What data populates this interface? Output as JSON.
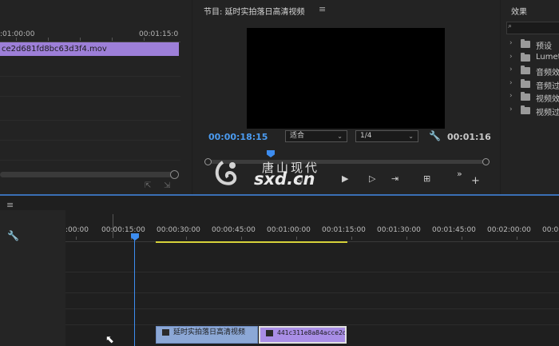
{
  "source": {
    "timecode_left": ":01:00:00",
    "timecode_right": "00:01:15:0",
    "clip_name": "ce2d681fd8bc63d3f4.mov",
    "btn_export": "⇱",
    "btn_insert": "⇲"
  },
  "program": {
    "title": "节目: 延时实拍落日高清视频",
    "menu": "≡",
    "timecode_current": "00:00:18:15",
    "fit_label": "适合",
    "quality_label": "1/4",
    "timecode_duration": "00:01:16",
    "controls": [
      "⇤",
      "◁",
      "▶",
      "▷",
      "⇥",
      "⊞",
      "»",
      "+"
    ]
  },
  "effects": {
    "title": "效果",
    "search_icon": "⌕",
    "items": [
      {
        "label": "预设"
      },
      {
        "label": "Lumet"
      },
      {
        "label": "音频效"
      },
      {
        "label": "音频过"
      },
      {
        "label": "视频效"
      },
      {
        "label": "视频过"
      }
    ]
  },
  "watermark": {
    "cn": "唐山现代",
    "en": "sxd.cn"
  },
  "timeline": {
    "menu": "≡",
    "ruler_labels": [
      ":00:00",
      "00:00:15:00",
      "00:00:30:00",
      "00:00:45:00",
      "00:01:00:00",
      "00:01:15:00",
      "00:01:30:00",
      "00:01:45:00",
      "00:02:00:00",
      "00:0"
    ],
    "clips": [
      {
        "name": "延时实拍落日高清视频"
      },
      {
        "name": "441c311e8a84acce2d"
      }
    ]
  },
  "colors": {
    "playhead": "#3d8df0",
    "clip_video": "#8ca8d6",
    "clip_audio": "#a98ee6",
    "work_area": "#d7d23a"
  }
}
